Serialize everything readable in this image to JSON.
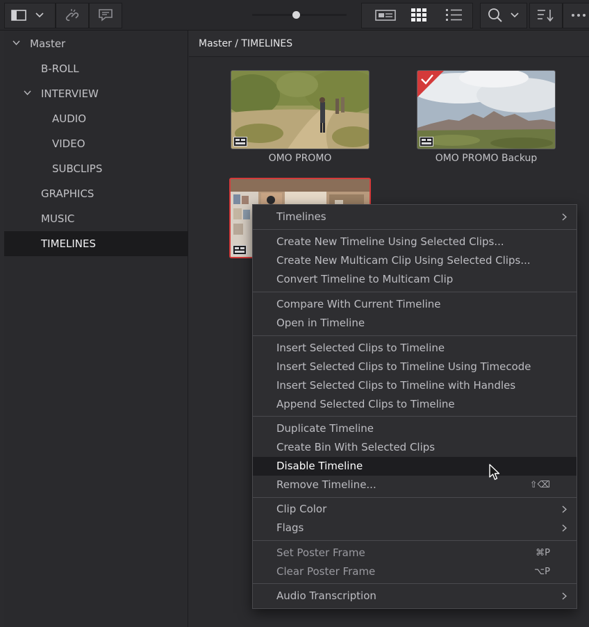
{
  "toolbar": {
    "icons": [
      "sidebar-toggle-icon",
      "chevron-down-icon",
      "unlink-icon",
      "metadata-icon",
      "zoom-slider",
      "metadata-view-icon",
      "thumbnail-view-icon",
      "list-view-icon",
      "search-icon",
      "chevron-down-icon",
      "sort-icon",
      "more-icon"
    ],
    "zoom_slider_level": 0.47
  },
  "sidebar": {
    "root": "Master",
    "items": [
      {
        "label": "B-ROLL"
      },
      {
        "label": "INTERVIEW"
      },
      {
        "label": "AUDIO"
      },
      {
        "label": "VIDEO"
      },
      {
        "label": "SUBCLIPS"
      },
      {
        "label": "GRAPHICS"
      },
      {
        "label": "MUSIC"
      },
      {
        "label": "TIMELINES"
      }
    ],
    "selected": "TIMELINES"
  },
  "breadcrumb": "Master / TIMELINES",
  "clips": [
    {
      "label": "OMO PROMO"
    },
    {
      "label": "OMO PROMO Backup"
    },
    {
      "label": ""
    }
  ],
  "context_menu": {
    "items": [
      {
        "label": "Timelines",
        "submenu": true
      },
      {
        "label": "Create New Timeline Using Selected Clips..."
      },
      {
        "label": "Create New Multicam Clip Using Selected Clips..."
      },
      {
        "label": "Convert Timeline to Multicam Clip"
      },
      {
        "label": "Compare With Current Timeline"
      },
      {
        "label": "Open in Timeline"
      },
      {
        "label": "Insert Selected Clips to Timeline"
      },
      {
        "label": "Insert Selected Clips to Timeline Using Timecode"
      },
      {
        "label": "Insert Selected Clips to Timeline with Handles"
      },
      {
        "label": "Append Selected Clips to Timeline"
      },
      {
        "label": "Duplicate Timeline"
      },
      {
        "label": "Create Bin With Selected Clips"
      },
      {
        "label": "Disable Timeline",
        "highlighted": true
      },
      {
        "label": "Remove Timeline...",
        "shortcut": "⇧⌫"
      },
      {
        "label": "Clip Color",
        "submenu": true
      },
      {
        "label": "Flags",
        "submenu": true
      },
      {
        "label": "Set Poster Frame",
        "shortcut": "⌘P"
      },
      {
        "label": "Clear Poster Frame",
        "shortcut": "⌥P"
      },
      {
        "label": "Audio Transcription",
        "submenu": true
      }
    ]
  },
  "colors": {
    "selection_red": "#d43a3a",
    "menu_highlight": "#1d1d20"
  }
}
